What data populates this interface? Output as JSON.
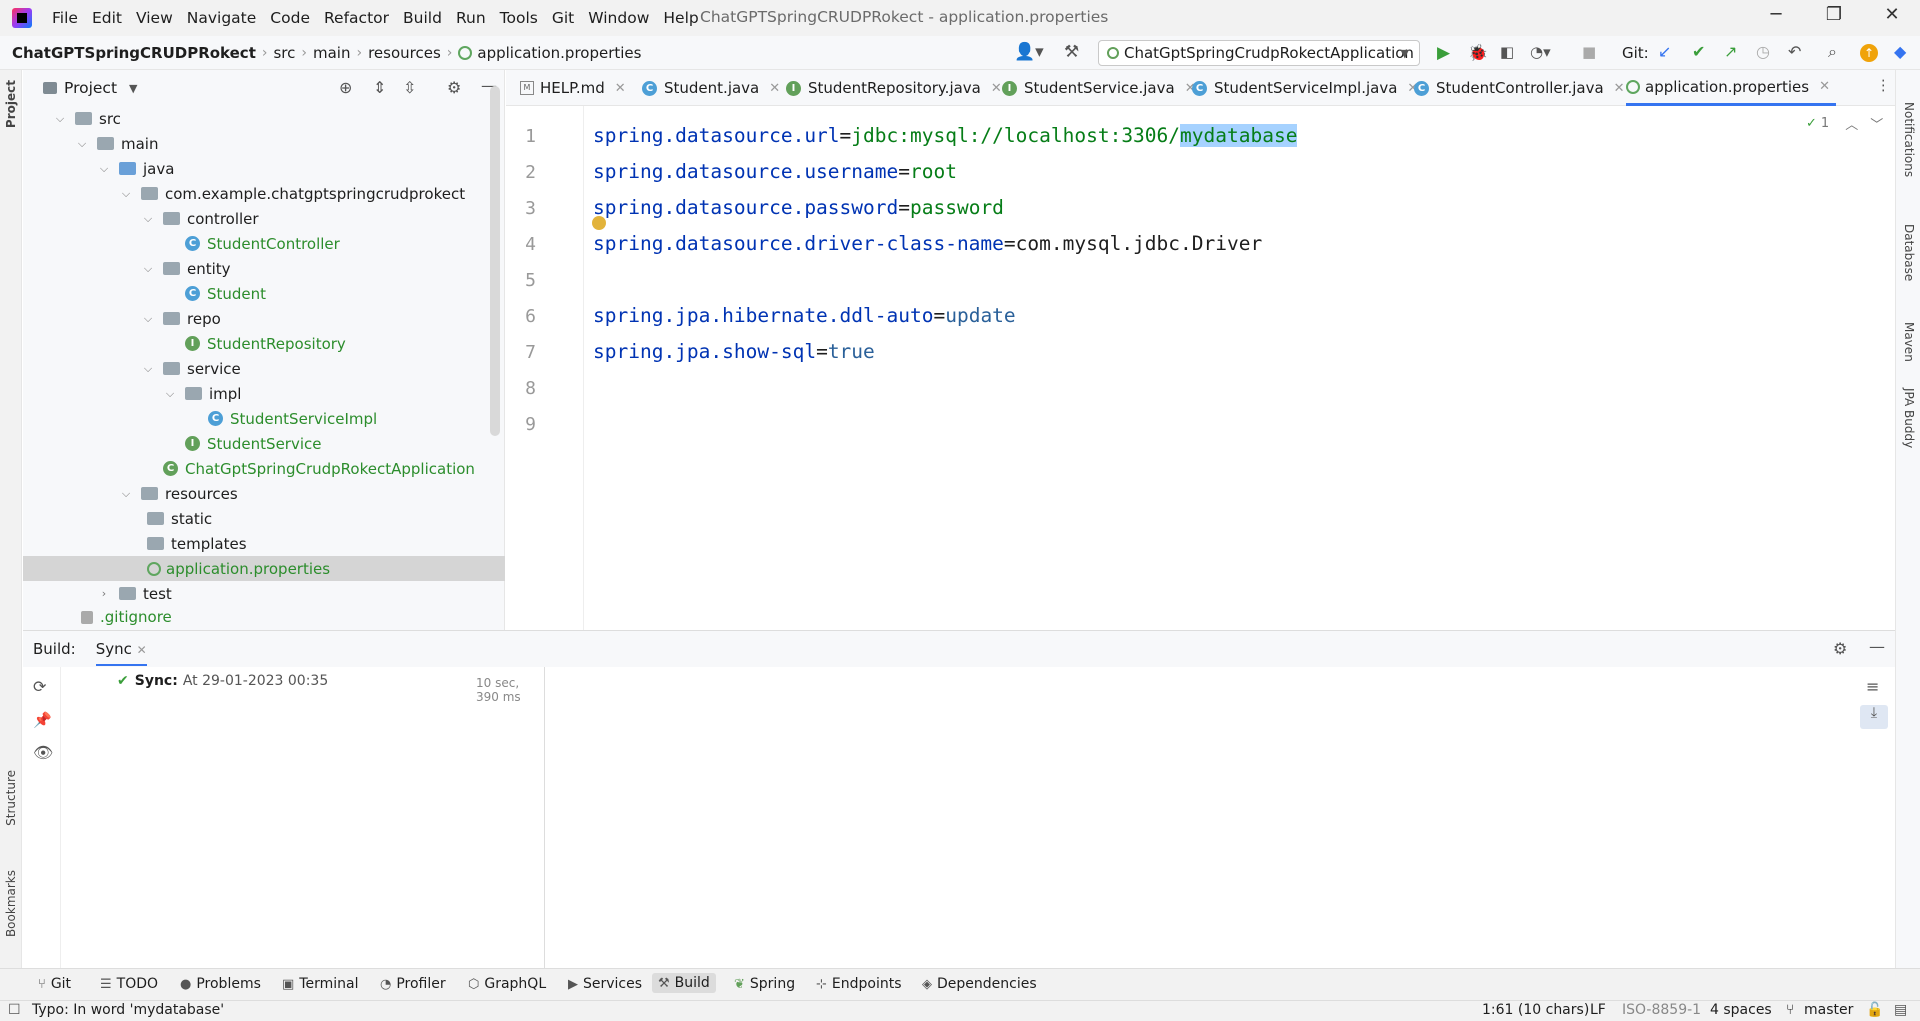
{
  "titlebar": {
    "menu": [
      "File",
      "Edit",
      "View",
      "Navigate",
      "Code",
      "Refactor",
      "Build",
      "Run",
      "Tools",
      "Git",
      "Window",
      "Help"
    ],
    "window_title": "ChatGPTSpringCRUDPRokect - application.properties",
    "buttons": {
      "minimize": "─",
      "restore": "❐",
      "close": "✕"
    }
  },
  "navbar": {
    "breadcrumbs": [
      "ChatGPTSpringCRUDPRokect",
      "src",
      "main",
      "resources",
      "application.properties"
    ],
    "run_config": "ChatGptSpringCrudpRokectApplication",
    "git_label": "Git:"
  },
  "project": {
    "title": "Project",
    "tree": [
      {
        "label": "src",
        "type": "folder"
      },
      {
        "label": "main",
        "type": "folder"
      },
      {
        "label": "java",
        "type": "folder-blue"
      },
      {
        "label": "com.example.chatgptspringcrudprokect",
        "type": "package"
      },
      {
        "label": "controller",
        "type": "package"
      },
      {
        "label": "StudentController",
        "type": "class"
      },
      {
        "label": "entity",
        "type": "package"
      },
      {
        "label": "Student",
        "type": "class"
      },
      {
        "label": "repo",
        "type": "package"
      },
      {
        "label": "StudentRepository",
        "type": "interface"
      },
      {
        "label": "service",
        "type": "package"
      },
      {
        "label": "impl",
        "type": "package"
      },
      {
        "label": "StudentServiceImpl",
        "type": "class"
      },
      {
        "label": "StudentService",
        "type": "interface"
      },
      {
        "label": "ChatGptSpringCrudpRokectApplication",
        "type": "app"
      },
      {
        "label": "resources",
        "type": "folder"
      },
      {
        "label": "static",
        "type": "folder"
      },
      {
        "label": "templates",
        "type": "folder"
      },
      {
        "label": "application.properties",
        "type": "props"
      },
      {
        "label": "test",
        "type": "folder"
      },
      {
        "label": ".gitignore",
        "type": "file"
      }
    ]
  },
  "editor": {
    "tabs": [
      "HELP.md",
      "Student.java",
      "StudentRepository.java",
      "StudentService.java",
      "StudentServiceImpl.java",
      "StudentController.java",
      "application.properties"
    ],
    "active_tab": "application.properties",
    "line_numbers": [
      "1",
      "2",
      "3",
      "4",
      "5",
      "6",
      "7",
      "8",
      "9"
    ],
    "lines": [
      {
        "key": "spring.datasource.url",
        "eq": "=",
        "val": "jdbc:mysql://localhost:3306/",
        "sel": "mydatabase"
      },
      {
        "key": "spring.datasource.username",
        "eq": "=",
        "val": "root"
      },
      {
        "key": "spring.datasource.password",
        "eq": "=",
        "val": "password"
      },
      {
        "key": "spring.datasource.driver-class-name",
        "eq": "=",
        "val": "com.mysql.jdbc.Driver"
      },
      {
        "key": "",
        "eq": "",
        "val": ""
      },
      {
        "key": "spring.jpa.hibernate.ddl-auto",
        "eq": "=",
        "val": "update"
      },
      {
        "key": "spring.jpa.show-sql",
        "eq": "=",
        "val": "true"
      }
    ],
    "hint_count": "1"
  },
  "build": {
    "label": "Build:",
    "tab": "Sync",
    "sync_title": "Sync:",
    "sync_time": "At 29-01-2023 00:35",
    "sync_duration": "10 sec, 390 ms"
  },
  "left_strip": {
    "project": "Project",
    "structure": "Structure",
    "bookmarks": "Bookmarks"
  },
  "right_strip": {
    "notifications": "Notifications",
    "database": "Database",
    "maven": "Maven",
    "jpa": "JPA Buddy"
  },
  "toolwindows": [
    "Git",
    "TODO",
    "Problems",
    "Terminal",
    "Profiler",
    "GraphQL",
    "Services",
    "Build",
    "Spring",
    "Endpoints",
    "Dependencies"
  ],
  "status": {
    "message": "Typo: In word 'mydatabase'",
    "position": "1:61 (10 chars)",
    "line_sep": "LF",
    "encoding": "ISO-8859-1",
    "indent": "4 spaces",
    "branch": "master"
  }
}
